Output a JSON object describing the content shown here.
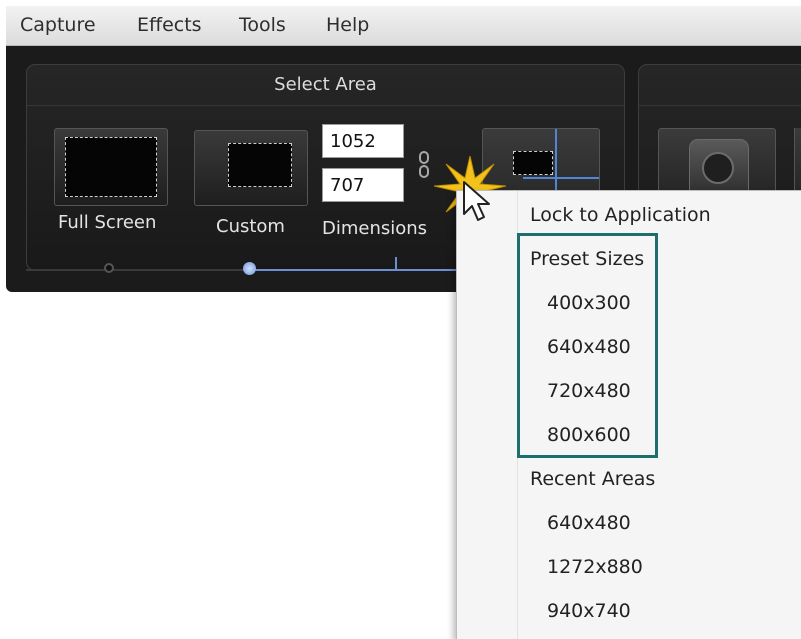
{
  "menubar": {
    "items": [
      "Capture",
      "Effects",
      "Tools",
      "Help"
    ]
  },
  "select_area": {
    "title": "Select Area",
    "full_screen_label": "Full Screen",
    "custom_label": "Custom",
    "dimensions_label": "Dimensions",
    "width_value": "1052",
    "height_value": "707"
  },
  "dropdown": {
    "lock_to_application": "Lock to Application",
    "preset_sizes_header": "Preset Sizes",
    "preset_sizes": [
      "400x300",
      "640x480",
      "720x480",
      "800x600"
    ],
    "recent_areas_header": "Recent Areas",
    "recent_areas": [
      "640x480",
      "1272x880",
      "940x740"
    ]
  },
  "colors": {
    "highlight_border": "#1e6e6e",
    "accent_blue": "#6b8fd1",
    "ribbon_background": "#1b1b1b"
  },
  "icons": [
    "link-chain-icon",
    "click-burst-icon",
    "mouse-pointer-icon",
    "webcam-icon"
  ]
}
